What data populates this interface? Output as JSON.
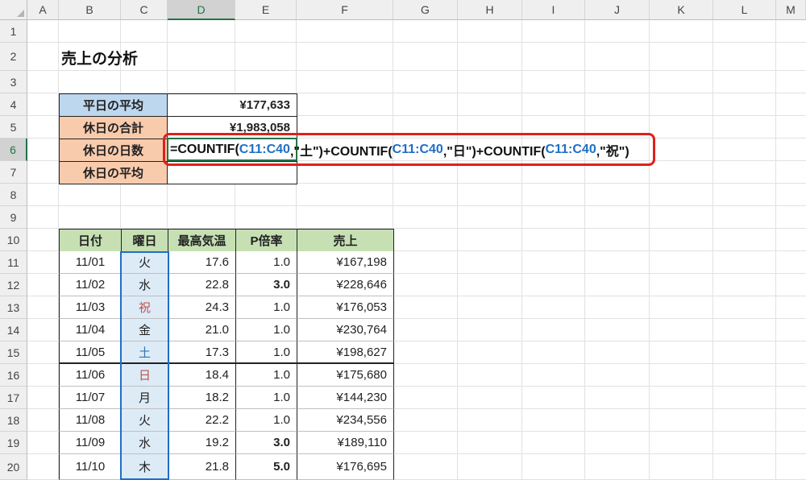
{
  "columns": [
    "A",
    "B",
    "C",
    "D",
    "E",
    "F",
    "G",
    "H",
    "I",
    "J",
    "K",
    "L",
    "M"
  ],
  "rows": [
    "1",
    "2",
    "3",
    "4",
    "5",
    "6",
    "7",
    "8",
    "9",
    "10",
    "11",
    "12",
    "13",
    "14",
    "15",
    "16",
    "17",
    "18",
    "19",
    "20"
  ],
  "title": "売上の分析",
  "summary": [
    {
      "label": "平日の平均",
      "value": "¥177,633"
    },
    {
      "label": "休日の合計",
      "value": "¥1,983,058"
    },
    {
      "label": "休日の日数",
      "value": ""
    },
    {
      "label": "休日の平均",
      "value": ""
    }
  ],
  "formula": {
    "p1": "=COUNTIF(",
    "ref1": "C11:C40",
    "p2": ",\"土\")+COUNTIF(",
    "ref2": "C11:C40",
    "p3": ",\"日\")+COUNTIF(",
    "ref3": "C11:C40",
    "p4": ",\"祝\")"
  },
  "table": {
    "headers": [
      "日付",
      "曜日",
      "最高気温",
      "P倍率",
      "売上"
    ],
    "rows": [
      {
        "date": "11/01",
        "day": "火",
        "temp": "17.6",
        "rate": "1.0",
        "sales": "¥167,198"
      },
      {
        "date": "11/02",
        "day": "水",
        "temp": "22.8",
        "rate": "3.0",
        "sales": "¥228,646"
      },
      {
        "date": "11/03",
        "day": "祝",
        "temp": "24.3",
        "rate": "1.0",
        "sales": "¥176,053"
      },
      {
        "date": "11/04",
        "day": "金",
        "temp": "21.0",
        "rate": "1.0",
        "sales": "¥230,764"
      },
      {
        "date": "11/05",
        "day": "土",
        "temp": "17.3",
        "rate": "1.0",
        "sales": "¥198,627"
      },
      {
        "date": "11/06",
        "day": "日",
        "temp": "18.4",
        "rate": "1.0",
        "sales": "¥175,680"
      },
      {
        "date": "11/07",
        "day": "月",
        "temp": "18.2",
        "rate": "1.0",
        "sales": "¥144,230"
      },
      {
        "date": "11/08",
        "day": "火",
        "temp": "22.2",
        "rate": "1.0",
        "sales": "¥234,556"
      },
      {
        "date": "11/09",
        "day": "水",
        "temp": "19.2",
        "rate": "3.0",
        "sales": "¥189,110"
      },
      {
        "date": "11/10",
        "day": "木",
        "temp": "21.8",
        "rate": "5.0",
        "sales": "¥176,695"
      }
    ]
  },
  "colors": {
    "accent_green": "#217346",
    "highlight_red": "#e0201b",
    "ref_blue": "#1f6fc5"
  }
}
